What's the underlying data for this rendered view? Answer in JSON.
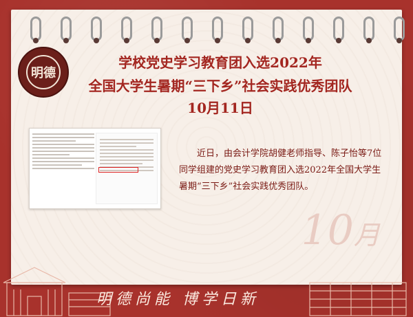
{
  "title": {
    "line1": "学校党史学习教育团入选2022年",
    "line2": "全国大学生暑期“三下乡”社会实践优秀团队",
    "line3": "10月11日"
  },
  "body": {
    "paragraph": "近日，由会计学院胡健老师指导、陈子怡等7位同学组建的党史学习教育团入选2022年全国大学生暑期“三下乡”社会实践优秀团队。"
  },
  "calendar": {
    "month_number": "10",
    "month_char": "月"
  },
  "motto": "明德尚能   博学日新",
  "logo": {
    "center_text": "明德",
    "icon": "university-seal"
  },
  "colors": {
    "background": "#a8322c",
    "title": "#a32620",
    "paper": "#f7efe8"
  }
}
